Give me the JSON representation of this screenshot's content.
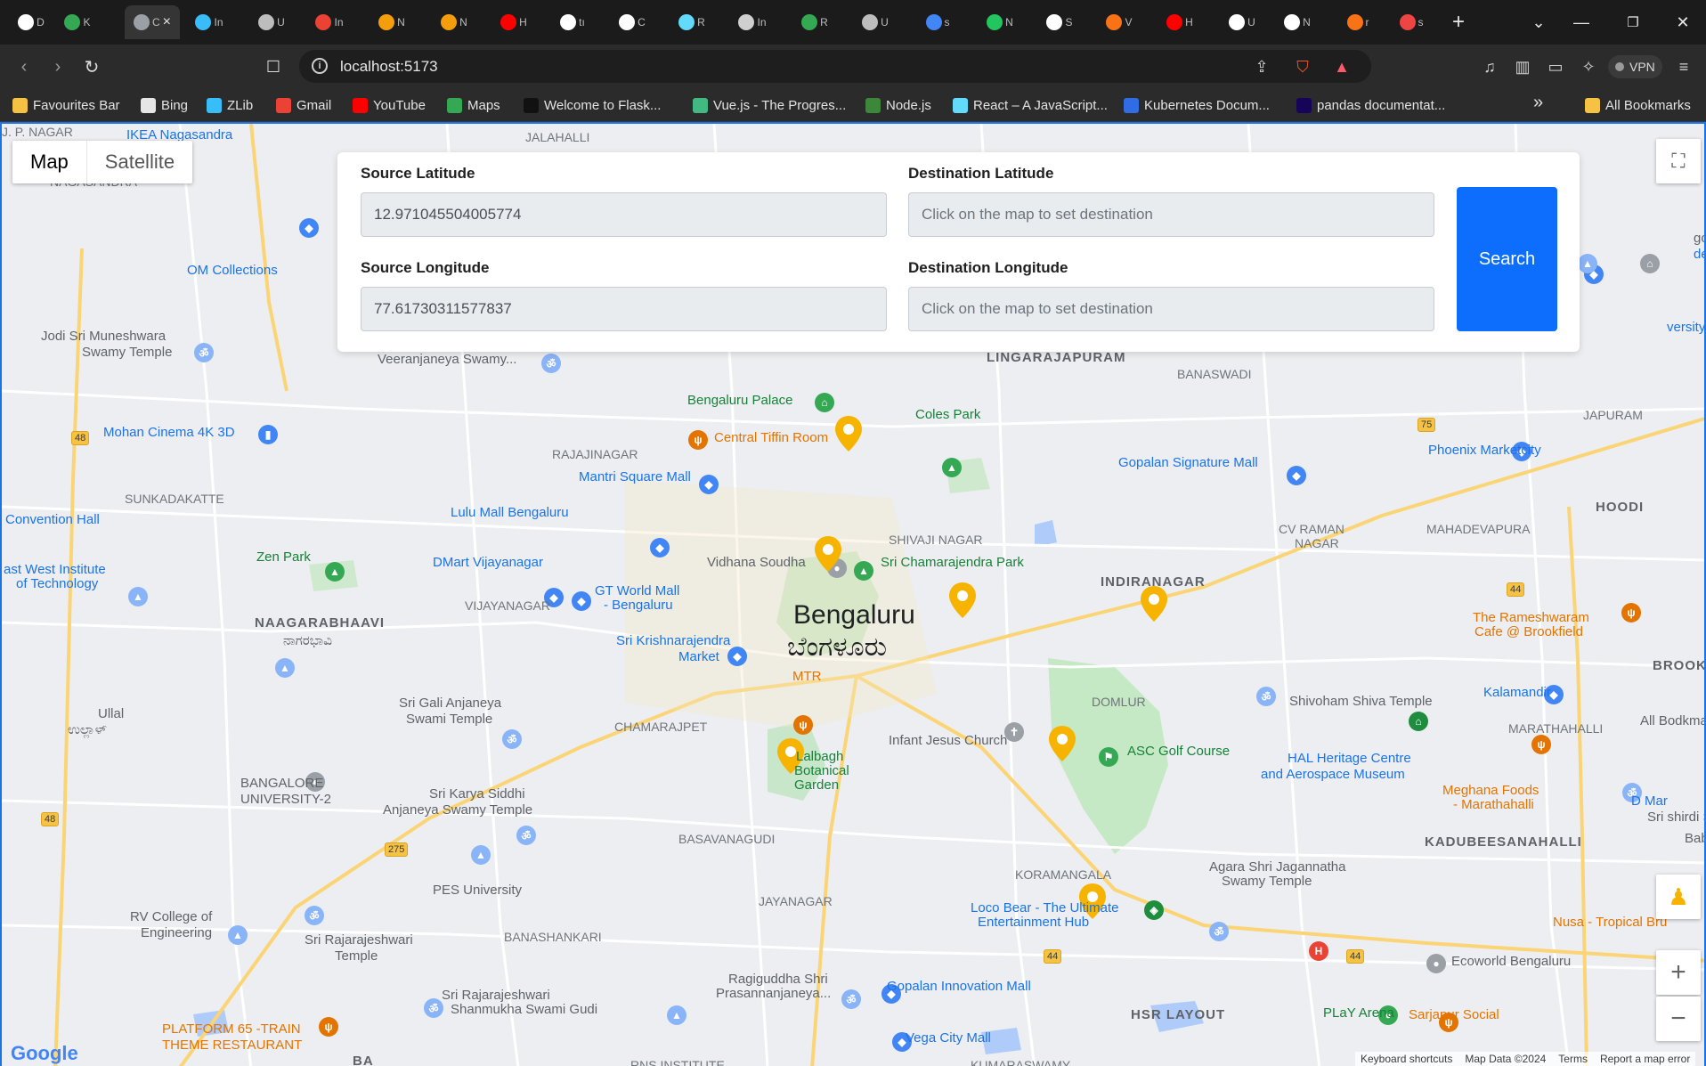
{
  "browser": {
    "tabs": [
      {
        "initial": "D",
        "color": "#ffffff"
      },
      {
        "initial": "K",
        "color": "#34a853"
      },
      {
        "initial": "C",
        "color": "#9aa0a6",
        "active": true
      },
      {
        "initial": "In",
        "color": "#38bdf8"
      },
      {
        "initial": "U",
        "color": "#bdbdbd"
      },
      {
        "initial": "In",
        "color": "#ea4335"
      },
      {
        "initial": "N",
        "color": "#f59e0b"
      },
      {
        "initial": "N",
        "color": "#f59e0b"
      },
      {
        "initial": "H",
        "color": "#ff0000"
      },
      {
        "initial": "tı",
        "color": "#ffffff"
      },
      {
        "initial": "C",
        "color": "#ffffff"
      },
      {
        "initial": "R",
        "color": "#61dafb"
      },
      {
        "initial": "In",
        "color": "#cfcfcf"
      },
      {
        "initial": "R",
        "color": "#34a853"
      },
      {
        "initial": "U",
        "color": "#bdbdbd"
      },
      {
        "initial": "s",
        "color": "#4285f4"
      },
      {
        "initial": "N",
        "color": "#22c55e"
      },
      {
        "initial": "S",
        "color": "#ffffff"
      },
      {
        "initial": "V",
        "color": "#f97316"
      },
      {
        "initial": "H",
        "color": "#ff0000"
      },
      {
        "initial": "U",
        "color": "#ffffff"
      },
      {
        "initial": "N",
        "color": "#ffffff"
      },
      {
        "initial": "r",
        "color": "#f97316"
      },
      {
        "initial": "s",
        "color": "#ef4444"
      }
    ],
    "close_tab_icon": "×",
    "new_tab_icon": "+",
    "url": "localhost:5173",
    "vpn_label": "VPN",
    "bookmarks": [
      {
        "label": "Favourites Bar",
        "color": "#f6c244"
      },
      {
        "label": "Bing",
        "color": "#e6e6e6"
      },
      {
        "label": "ZLib",
        "color": "#38bdf8"
      },
      {
        "label": "Gmail",
        "color": "#ea4335"
      },
      {
        "label": "YouTube",
        "color": "#ff0000"
      },
      {
        "label": "Maps",
        "color": "#34a853"
      },
      {
        "label": "Welcome to Flask...",
        "color": "#111111"
      },
      {
        "label": "Vue.js - The Progres...",
        "color": "#42b883"
      },
      {
        "label": "Node.js",
        "color": "#3c873a"
      },
      {
        "label": "React – A JavaScript...",
        "color": "#61dafb"
      },
      {
        "label": "Kubernetes Docum...",
        "color": "#326ce5"
      },
      {
        "label": "pandas documentat...",
        "color": "#150458"
      }
    ],
    "all_bookmarks_label": "All Bookmarks",
    "overflow_icon": "»"
  },
  "map": {
    "type_buttons": {
      "map": "Map",
      "satellite": "Satellite"
    },
    "city_label": "Bengaluru",
    "city_label_kn": "ಬೆಂಗಳೂರು",
    "attribution": {
      "logo": "Google",
      "shortcuts": "Keyboard shortcuts",
      "data": "Map Data ©2024",
      "terms": "Terms",
      "report": "Report a map error"
    },
    "labels": [
      {
        "text": "IKEA Nagasandra",
        "class": "poi"
      },
      {
        "text": "JALAHALLI",
        "class": "gray"
      },
      {
        "text": "OM Collections",
        "class": "poi"
      },
      {
        "text": "Jodi Sri Muneshwara",
        "class": ""
      },
      {
        "text": "Swamy Temple",
        "class": ""
      },
      {
        "text": "Mohan Cinema 4K 3D",
        "class": "poi"
      },
      {
        "text": "Convention Hall",
        "class": "poi"
      },
      {
        "text": "Zen Park",
        "class": "poi-g"
      },
      {
        "text": "ast West Institute",
        "class": "poi"
      },
      {
        "text": "of Technology",
        "class": "poi"
      },
      {
        "text": "NAAGARABHAAVI",
        "class": "area"
      },
      {
        "text": "ನಾಗರಭಾವಿ",
        "class": ""
      },
      {
        "text": "Ullal",
        "class": ""
      },
      {
        "text": "ಉಲ್ಲಾಳ್",
        "class": ""
      },
      {
        "text": "Sri Gali Anjaneya",
        "class": ""
      },
      {
        "text": "Swami Temple",
        "class": ""
      },
      {
        "text": "BANGALORE",
        "class": ""
      },
      {
        "text": "UNIVERSITY-2",
        "class": ""
      },
      {
        "text": "Sri Karya Siddhi",
        "class": ""
      },
      {
        "text": "Anjaneya Swamy Temple",
        "class": ""
      },
      {
        "text": "PES University",
        "class": ""
      },
      {
        "text": "RV College of",
        "class": ""
      },
      {
        "text": "Engineering",
        "class": ""
      },
      {
        "text": "Sri Rajarajeshwari",
        "class": ""
      },
      {
        "text": "Temple",
        "class": ""
      },
      {
        "text": "PLATFORM 65 -TRAIN",
        "class": "poi-o"
      },
      {
        "text": "THEME RESTAURANT",
        "class": "poi-o"
      },
      {
        "text": "Veeranjaneya Swamy...",
        "class": ""
      },
      {
        "text": "Bengaluru Palace",
        "class": "poi-g"
      },
      {
        "text": "Central Tiffin Room",
        "class": "poi-o"
      },
      {
        "text": "RAJAJINAGAR",
        "class": "gray"
      },
      {
        "text": "Mantri Square Mall",
        "class": "poi"
      },
      {
        "text": "Lulu Mall Bengaluru",
        "class": "poi"
      },
      {
        "text": "DMart Vijayanagar",
        "class": "poi"
      },
      {
        "text": "GT World Mall",
        "class": "poi"
      },
      {
        "text": "- Bengaluru",
        "class": "poi"
      },
      {
        "text": "Sri Krishnarajendra",
        "class": "poi"
      },
      {
        "text": "Market",
        "class": "poi"
      },
      {
        "text": "Vidhana Soudha",
        "class": ""
      },
      {
        "text": "Sri Chamarajendra Park",
        "class": "poi-g"
      },
      {
        "text": "MTR",
        "class": "poi-o"
      },
      {
        "text": "Lalbagh",
        "class": "poi-g"
      },
      {
        "text": "Botanical",
        "class": "poi-g"
      },
      {
        "text": "Garden",
        "class": "poi-g"
      },
      {
        "text": "Infant Jesus Church",
        "class": ""
      },
      {
        "text": "Coles Park",
        "class": "poi-g"
      },
      {
        "text": "LINGARAJAPURAM",
        "class": "area"
      },
      {
        "text": "Gopalan Signature Mall",
        "class": "poi"
      },
      {
        "text": "Phoenix Marketcity",
        "class": "poi"
      },
      {
        "text": "INDIRANAGAR",
        "class": "area"
      },
      {
        "text": "The Rameshwaram",
        "class": "poi-o"
      },
      {
        "text": "Cafe @ Brookfield",
        "class": "poi-o"
      },
      {
        "text": "HOODI",
        "class": "area"
      },
      {
        "text": "BROOKEFIELD",
        "class": "area"
      },
      {
        "text": "Shivoham Shiva Temple",
        "class": ""
      },
      {
        "text": "Kalamandir",
        "class": "poi"
      },
      {
        "text": "ASC Golf Course",
        "class": "poi-g"
      },
      {
        "text": "HAL Heritage Centre",
        "class": "poi"
      },
      {
        "text": "and Aerospace Museum",
        "class": "poi"
      },
      {
        "text": "Meghana Foods",
        "class": "poi-o"
      },
      {
        "text": "- Marathahalli",
        "class": "poi-o"
      },
      {
        "text": "KADUBEESANAHALLI",
        "class": "area"
      },
      {
        "text": "Agara Shri Jagannatha",
        "class": ""
      },
      {
        "text": "Swamy Temple",
        "class": ""
      },
      {
        "text": "Loco Bear - The Ultimate",
        "class": "poi"
      },
      {
        "text": "Entertainment Hub",
        "class": "poi"
      },
      {
        "text": "Nusa - Tropical Bru",
        "class": "poi-o"
      },
      {
        "text": "Ecoworld Bengaluru",
        "class": ""
      },
      {
        "text": "Gopalan Innovation Mall",
        "class": "poi"
      },
      {
        "text": "Vega City Mall",
        "class": "poi"
      },
      {
        "text": "HSR LAYOUT",
        "class": "area"
      },
      {
        "text": "PLaY Arena",
        "class": "poi-g"
      },
      {
        "text": "Sarjapur Social",
        "class": "poi-o"
      },
      {
        "text": "Ragiguddha Shri",
        "class": ""
      },
      {
        "text": "Prasannanjaneya...",
        "class": ""
      },
      {
        "text": "Sri Rajarajeshwari",
        "class": ""
      },
      {
        "text": "Shanmukha Swami Gudi",
        "class": ""
      },
      {
        "text": "CHAMARAJPET",
        "class": "gray"
      },
      {
        "text": "BASAVANAGUDI",
        "class": "gray"
      },
      {
        "text": "JAYANAGAR",
        "class": "gray"
      },
      {
        "text": "BANASHANKARI",
        "class": "gray"
      },
      {
        "text": "DOMLUR",
        "class": "gray"
      },
      {
        "text": "KORAMANGALA",
        "class": "gray"
      },
      {
        "text": "SHIVAJI NAGAR",
        "class": "gray"
      },
      {
        "text": "CV RAMAN",
        "class": "gray"
      },
      {
        "text": "NAGAR",
        "class": "gray"
      },
      {
        "text": "MAHADEVAPURA",
        "class": "gray"
      },
      {
        "text": "MARATHAHALLI",
        "class": "gray"
      },
      {
        "text": "SUNKADAKATTE",
        "class": "gray"
      },
      {
        "text": "VIJAYANAGAR",
        "class": "gray"
      },
      {
        "text": "BANASWADI",
        "class": "gray"
      },
      {
        "text": "NAGASANDRA",
        "class": "gray"
      },
      {
        "text": "gondanahalli",
        "class": ""
      },
      {
        "text": "den City",
        "class": "poi"
      },
      {
        "text": "versity",
        "class": "poi"
      },
      {
        "text": "JAPURAM",
        "class": "gray"
      },
      {
        "text": "All Bodkmarks",
        "class": ""
      },
      {
        "text": "D Mar",
        "class": "poi"
      },
      {
        "text": "Sri shirdi Sa",
        "class": ""
      },
      {
        "text": "Baba Templ",
        "class": ""
      },
      {
        "text": "BA",
        "class": "area"
      },
      {
        "text": "RNS INSTITUTE",
        "class": "gray"
      },
      {
        "text": "KUMARASWAMY",
        "class": "gray"
      },
      {
        "text": "J. P. NAGAR",
        "class": "gray"
      }
    ]
  },
  "form": {
    "source_latitude_label": "Source Latitude",
    "source_latitude_value": "12.971045504005774",
    "source_longitude_label": "Source Longitude",
    "source_longitude_value": "77.61730311577837",
    "destination_latitude_label": "Destination Latitude",
    "destination_latitude_placeholder": "Click on the map to set destination",
    "destination_longitude_label": "Destination Longitude",
    "destination_longitude_placeholder": "Click on the map to set destination",
    "search_label": "Search"
  },
  "colors": {
    "search_button": "#0d6efd",
    "map_background": "#eceef1",
    "marker_yellow": "#f6b400"
  }
}
